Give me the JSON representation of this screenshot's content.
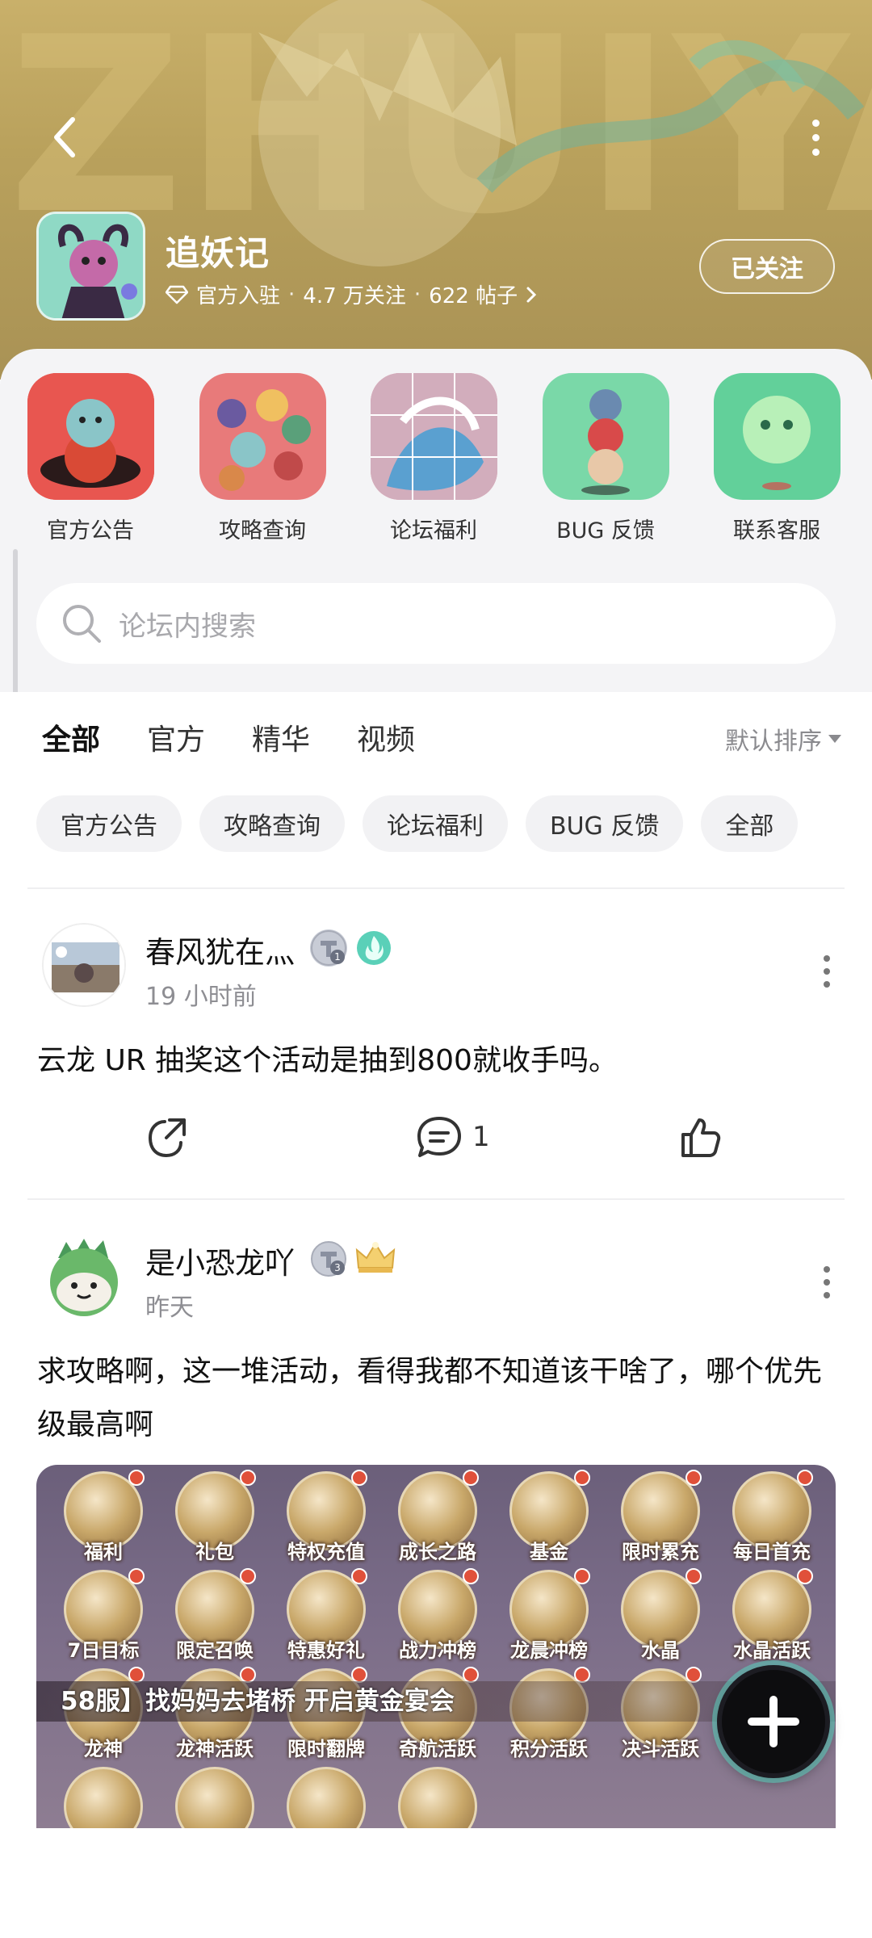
{
  "header": {
    "title": "追妖记",
    "official_tag": "官方入驻",
    "followers": "4.7 万关注",
    "posts": "622 帖子",
    "follow_button": "已关注",
    "banner_watermark": "ZHUIYAOJI"
  },
  "shortcuts": [
    {
      "label": "官方公告"
    },
    {
      "label": "攻略查询"
    },
    {
      "label": "论坛福利"
    },
    {
      "label": "BUG 反馈"
    },
    {
      "label": "联系客服"
    }
  ],
  "search": {
    "placeholder": "论坛内搜索"
  },
  "tabs": [
    {
      "label": "全部",
      "active": true
    },
    {
      "label": "官方",
      "active": false
    },
    {
      "label": "精华",
      "active": false
    },
    {
      "label": "视频",
      "active": false
    }
  ],
  "sort": {
    "label": "默认排序"
  },
  "chips": [
    {
      "label": "官方公告"
    },
    {
      "label": "攻略查询"
    },
    {
      "label": "论坛福利"
    },
    {
      "label": "BUG 反馈"
    },
    {
      "label": "全部"
    }
  ],
  "posts": [
    {
      "author": "春风犹在灬",
      "time": "19 小时前",
      "text": "云龙 UR 抽奖这个活动是抽到800就收手吗。",
      "comments": "1",
      "level_badge": "1"
    },
    {
      "author": "是小恐龙吖",
      "time": "昨天",
      "text": "求攻略啊，这一堆活动，看得我都不知道该干啥了，哪个优先级最高啊",
      "level_badge": "3",
      "image": {
        "grid": [
          [
            "福利",
            "礼包",
            "特权充值",
            "成长之路",
            "基金",
            "限时累充",
            "每日首充"
          ],
          [
            "7日目标",
            "限定召唤",
            "特惠好礼",
            "战力冲榜",
            "龙晨冲榜",
            "水晶",
            "水晶活跃"
          ],
          [
            "龙神",
            "龙神活跃",
            "限时翻牌",
            "奇航活跃",
            "积分活跃",
            "决斗活跃",
            ""
          ]
        ],
        "marquee": "58服】找妈妈去堵桥 开启黄金宴会"
      }
    }
  ],
  "colors": {
    "accent": "#3ed3b9",
    "banner": "#b9a15c",
    "fab": "#0d0d0f"
  }
}
